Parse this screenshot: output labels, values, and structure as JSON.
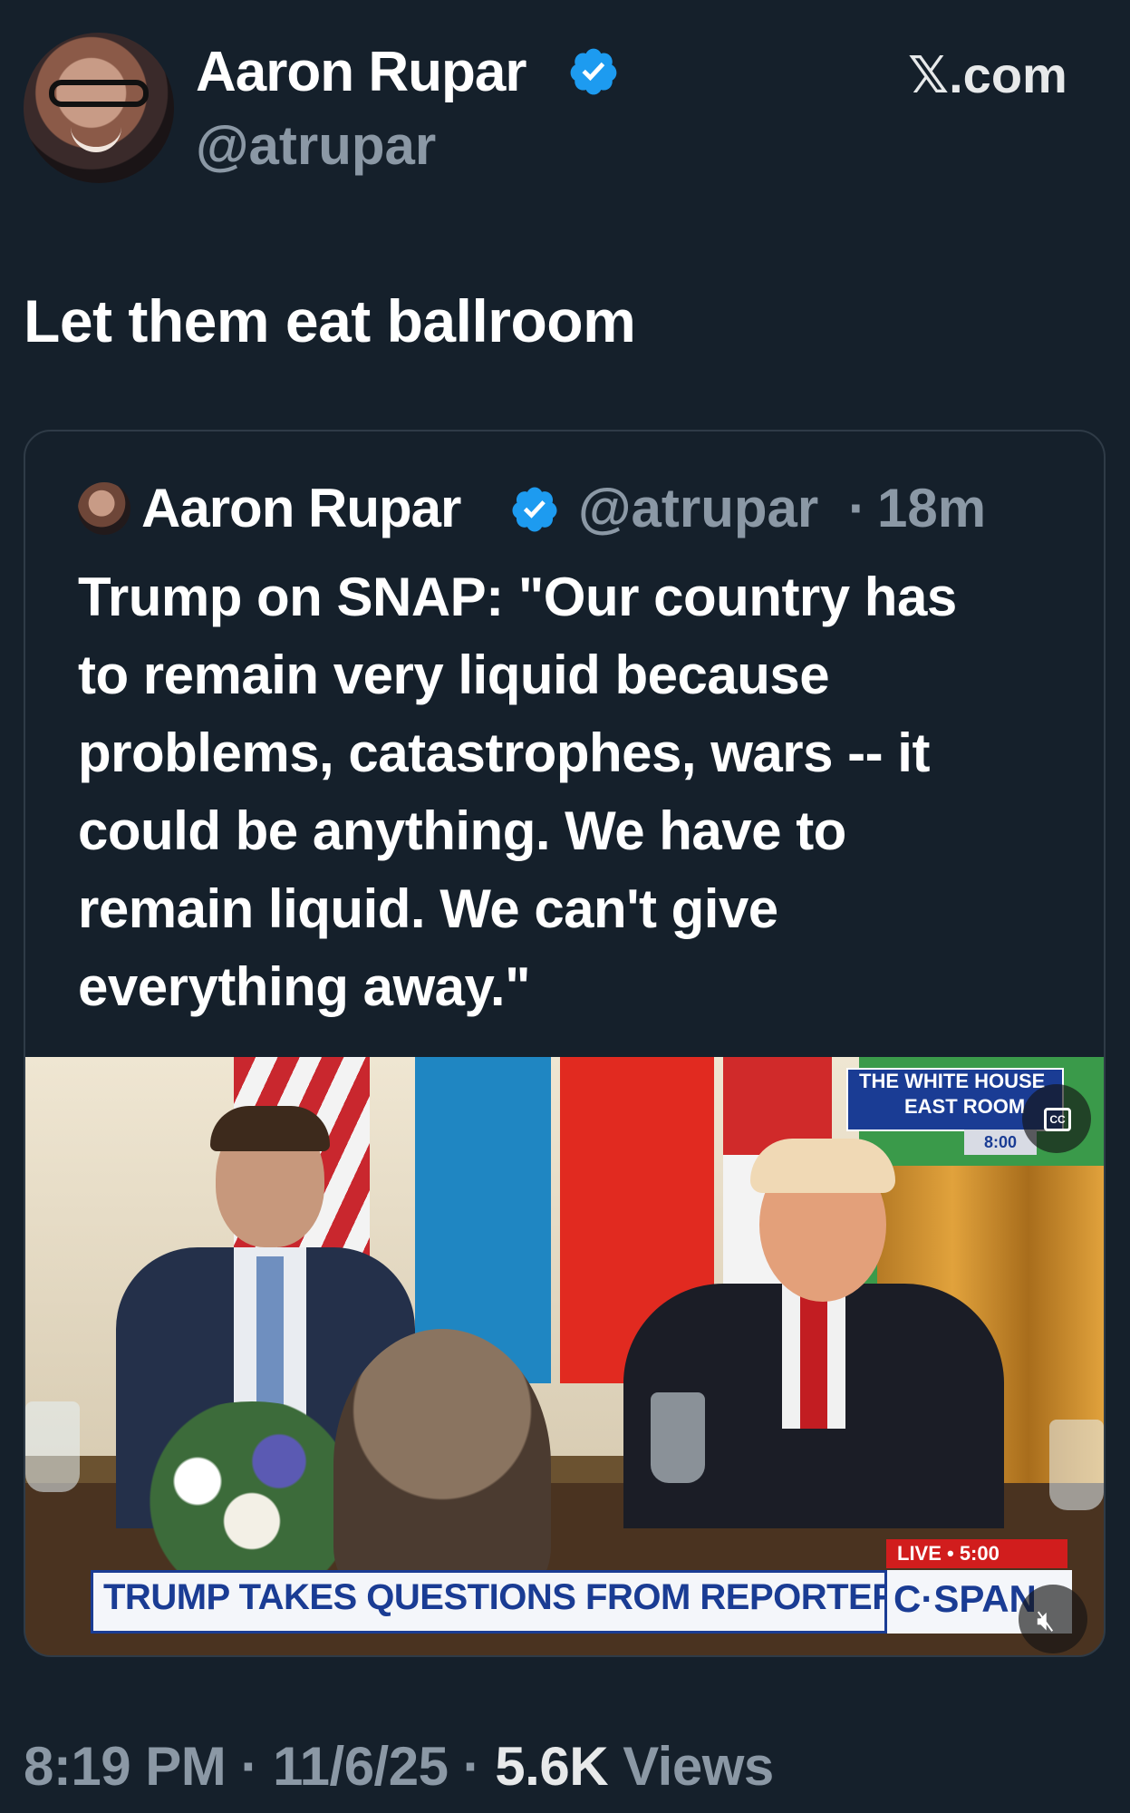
{
  "header": {
    "author_name": "Aaron Rupar",
    "handle": "@atrupar",
    "site_label": "𝕏.com",
    "verified_color": "#1d9bf0"
  },
  "tweet": {
    "text": "Let them eat ballroom"
  },
  "quoted_tweet": {
    "author_name": "Aaron Rupar",
    "handle": "@atrupar",
    "separator": "·",
    "time": "18m",
    "text": "Trump on SNAP: \"Our country has\nto remain very liquid because\nproblems, catastrophes, wars -- it\ncould be anything. We have to\nremain liquid. We can't give\neverything away.\"",
    "media": {
      "overlay_top_line1": "THE WHITE HOUSE",
      "overlay_top_line2": "EAST ROOM",
      "overlay_time": "8:00",
      "live_label": "LIVE • 5:00",
      "lower_third": "TRUMP TAKES QUESTIONS FROM REPORTERS",
      "network": "C·SPAN",
      "captions_icon": "cc-icon",
      "mute_icon": "speaker-muted-icon"
    }
  },
  "footer": {
    "time": "8:19 PM",
    "date": "11/6/25",
    "views_count": "5.6K",
    "views_label": "Views",
    "separator": "·"
  }
}
